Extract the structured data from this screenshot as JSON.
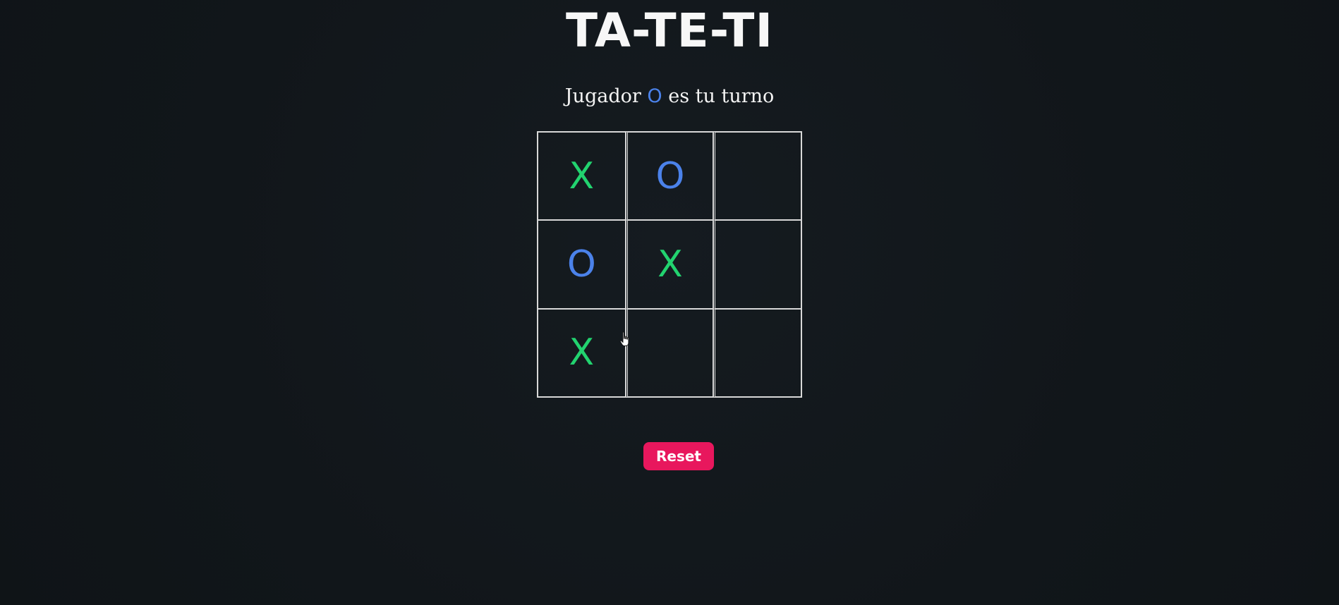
{
  "title": "TA-TE-TI",
  "turn": {
    "prefix": "Jugador",
    "player": "O",
    "suffix": "es tu turno"
  },
  "board": {
    "cells": [
      "X",
      "O",
      "",
      "O",
      "X",
      "",
      "X",
      "",
      ""
    ]
  },
  "reset_label": "Reset",
  "colors": {
    "x": "#22d36f",
    "o": "#4b82ea",
    "reset": "#e8175d",
    "background": "#12171b"
  }
}
